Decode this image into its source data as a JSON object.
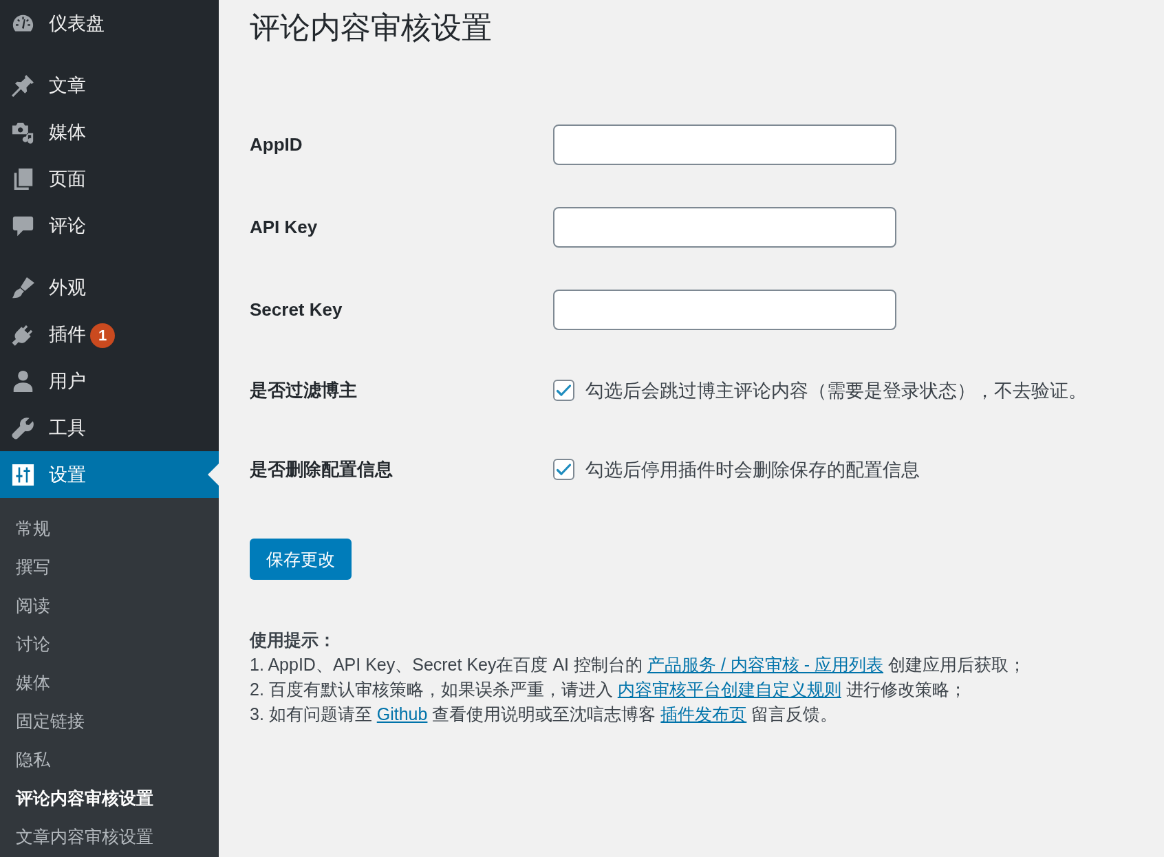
{
  "sidebar": {
    "menu_groups": [
      {
        "items": [
          {
            "label": "仪表盘",
            "selected": false
          }
        ]
      },
      {
        "items": [
          {
            "label": "文章",
            "selected": false
          },
          {
            "label": "媒体",
            "selected": false
          },
          {
            "label": "页面",
            "selected": false
          },
          {
            "label": "评论",
            "selected": false
          }
        ]
      },
      {
        "items": [
          {
            "label": "外观",
            "selected": false
          },
          {
            "label": "插件",
            "selected": false,
            "badge": "1"
          },
          {
            "label": "用户",
            "selected": false
          },
          {
            "label": "工具",
            "selected": false
          },
          {
            "label": "设置",
            "selected": true,
            "children": [
              {
                "label": "常规",
                "selected": false
              },
              {
                "label": "撰写",
                "selected": false
              },
              {
                "label": "阅读",
                "selected": false
              },
              {
                "label": "讨论",
                "selected": false
              },
              {
                "label": "媒体",
                "selected": false
              },
              {
                "label": "固定链接",
                "selected": false
              },
              {
                "label": "隐私",
                "selected": false
              },
              {
                "label": "评论内容审核设置",
                "selected": true
              },
              {
                "label": "文章内容审核设置",
                "selected": false
              }
            ]
          }
        ]
      }
    ]
  },
  "page": {
    "title": "评论内容审核设置"
  },
  "form": {
    "fields": [
      {
        "kind": "text",
        "label": "AppID"
      },
      {
        "kind": "text",
        "label": "API Key"
      },
      {
        "kind": "text",
        "label": "Secret Key"
      },
      {
        "kind": "checkbox",
        "label": "是否过滤博主",
        "checked": true,
        "description": "勾选后会跳过博主评论内容（需要是登录状态），不去验证。"
      },
      {
        "kind": "checkbox",
        "label": "是否删除配置信息",
        "checked": true,
        "description": "勾选后停用插件时会删除保存的配置信息"
      }
    ],
    "submit": {
      "label": "保存更改"
    }
  },
  "help": {
    "title": "使用提示：",
    "lines": [
      {
        "parts": [
          {
            "kind": "text",
            "text": "1. AppID、API Key、Secret Key在百度 AI 控制台的 "
          },
          {
            "kind": "link",
            "text": "产品服务 / 内容审核 - 应用列表"
          },
          {
            "kind": "text",
            "text": " 创建应用后获取；"
          }
        ]
      },
      {
        "parts": [
          {
            "kind": "text",
            "text": "2. 百度有默认审核策略，如果误杀严重，请进入 "
          },
          {
            "kind": "link",
            "text": "内容审核平台创建自定义规则"
          },
          {
            "kind": "text",
            "text": " 进行修改策略；"
          }
        ]
      },
      {
        "parts": [
          {
            "kind": "text",
            "text": "3. 如有问题请至 "
          },
          {
            "kind": "link",
            "text": "Github"
          },
          {
            "kind": "text",
            "text": " 查看使用说明或至沈唁志博客 "
          },
          {
            "kind": "link",
            "text": "插件发布页"
          },
          {
            "kind": "text",
            "text": " 留言反馈。"
          }
        ]
      }
    ]
  }
}
